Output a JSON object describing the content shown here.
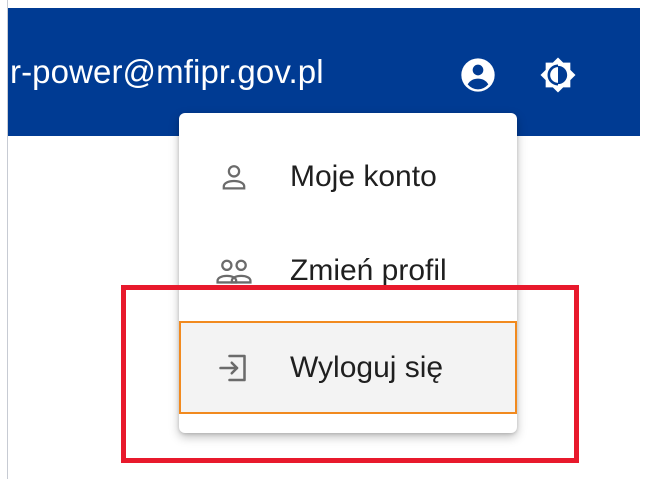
{
  "header": {
    "email": "r-power@mfipr.gov.pl",
    "account_icon": "account-circle-icon",
    "theme_icon": "brightness-toggle-icon",
    "background_color": "#003b93"
  },
  "user_menu": {
    "items": [
      {
        "label": "Moje konto",
        "icon": "person-icon"
      },
      {
        "label": "Zmień profil",
        "icon": "people-icon"
      },
      {
        "label": "Wyloguj się",
        "icon": "logout-icon"
      }
    ],
    "focused_item": "Wyloguj się",
    "focus_color": "#f18a1f"
  },
  "annotation": {
    "highlight_color": "#e8192c"
  }
}
